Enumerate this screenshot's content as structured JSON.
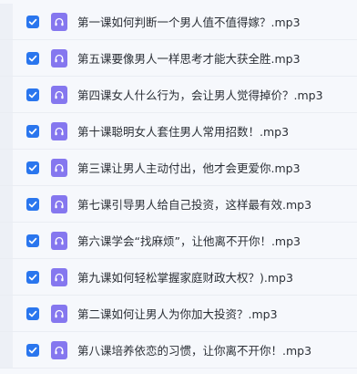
{
  "files": [
    {
      "name": "第一课如何判断一个男人值不值得嫁？.mp3",
      "checked": true
    },
    {
      "name": "第五课要像男人一样思考才能大获全胜.mp3",
      "checked": true
    },
    {
      "name": "第四课女人什么行为，会让男人觉得掉价？.mp3",
      "checked": true
    },
    {
      "name": "第十课聪明女人套住男人常用招数！.mp3",
      "checked": true
    },
    {
      "name": "第三课让男人主动付出，他才会更爱你.mp3",
      "checked": true
    },
    {
      "name": "第七课引导男人给自己投资，这样最有效.mp3",
      "checked": true
    },
    {
      "name": "第六课学会“找麻烦”，让他离不开你！.mp3",
      "checked": true
    },
    {
      "name": "第九课如何轻松掌握家庭财政大权？).mp3",
      "checked": true
    },
    {
      "name": "第二课如何让男人为你加大投资？.mp3",
      "checked": true
    },
    {
      "name": "第八课培养依恋的习惯，让你离不开你！.mp3",
      "checked": true
    }
  ],
  "icons": {
    "checkbox": "checkmark-icon",
    "file": "headphones-icon"
  },
  "colors": {
    "checkbox": "#2a76ee",
    "file_icon": "#8577ef"
  }
}
